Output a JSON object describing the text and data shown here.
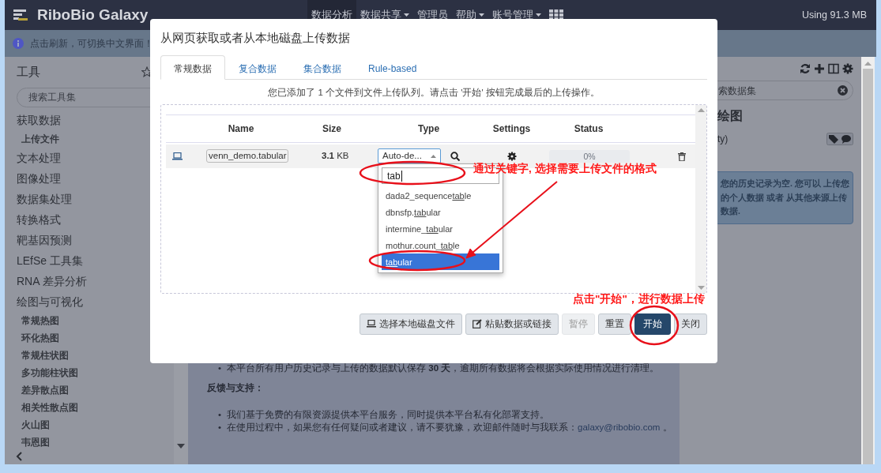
{
  "navbar": {
    "brand": "RiboBio Galaxy",
    "menu": [
      {
        "label": "数据分析",
        "dropdown": false,
        "selected": true
      },
      {
        "label": "数据共享",
        "dropdown": true,
        "selected": false
      },
      {
        "label": "管理员",
        "dropdown": false,
        "selected": false
      },
      {
        "label": "帮助",
        "dropdown": true,
        "selected": false
      },
      {
        "label": "账号管理",
        "dropdown": true,
        "selected": false
      }
    ],
    "usage": "Using 91.3 MB"
  },
  "notice": {
    "text": "点击刷新，可切换中文界面！"
  },
  "tool_panel": {
    "title": "工具",
    "search": {
      "placeholder": "搜索工具集"
    },
    "sections": [
      {
        "label": "获取数据",
        "children": [
          {
            "label": "上传文件"
          }
        ]
      },
      {
        "label": "文本处理"
      },
      {
        "label": "图像处理"
      },
      {
        "label": "数据集处理"
      },
      {
        "label": "转换格式"
      },
      {
        "label": "靶基因预测"
      },
      {
        "label": "LEfSe 工具集"
      },
      {
        "label": "RNA 差异分析"
      },
      {
        "label": "绘图与可视化",
        "children": [
          {
            "label": "常规热图"
          },
          {
            "label": "环化热图"
          },
          {
            "label": "常规柱状图"
          },
          {
            "label": "多功能柱状图"
          },
          {
            "label": "差异散点图"
          },
          {
            "label": "相关性散点图"
          },
          {
            "label": "火山图"
          },
          {
            "label": "韦恩图"
          }
        ]
      }
    ]
  },
  "center": {
    "top_bullets": [
      {
        "marker": "•",
        "text": "本平台所有用户历史记录与上传的数据默认保存 **30 天**，逾期所有数据将会根据实际使用情况进行清理。"
      }
    ],
    "heading": "反馈与支持：",
    "bullets": [
      {
        "marker": "•",
        "text": "我们基于免费的有限资源提供本平台服务，同时提供本平台私有化部署支持。"
      },
      {
        "marker": "•",
        "text": "在使用过程中，如果您有任何疑问或者建议，请不要犹豫，欢迎邮件随时与我联系：",
        "link": "galaxy@ribobio.com",
        "after": " 。"
      }
    ]
  },
  "history_panel": {
    "search": {
      "placeholder": "索数据集"
    },
    "title": "绘图",
    "subtitle": "ty)",
    "alert_lines": [
      "您的历史记录为空. 您可以 上传您",
      "的个人数据 或者 从其他来源上传",
      "数据."
    ]
  },
  "upload_dialog": {
    "title": "从网页获取或者从本地磁盘上传数据",
    "tabs": [
      {
        "label": "常规数据",
        "selected": true
      },
      {
        "label": "复合数据",
        "selected": false
      },
      {
        "label": "集合数据",
        "selected": false
      },
      {
        "label": "Rule-based",
        "selected": false
      }
    ],
    "message": "您已添加了 1 个文件到文件上传队列。请点击 '开始' 按钮完成最后的上传操作。",
    "columns": [
      "Name",
      "Size",
      "Type",
      "Settings",
      "Status"
    ],
    "files": [
      {
        "name": "venn_demo.tabular",
        "size": "**3.1** KB",
        "type": "Auto-de...",
        "progress": {
          "level": 0,
          "label": "0%"
        }
      }
    ],
    "type_dropdown": {
      "query": "tab",
      "options": [
        {
          "before": "dada2_sequence",
          "match": "tab",
          "after": "le",
          "selected": false
        },
        {
          "before": "dbnsfp.",
          "match": "tab",
          "after": "ular",
          "selected": false
        },
        {
          "before": "intermine_",
          "match": "tab",
          "after": "ular",
          "selected": false
        },
        {
          "before": "mothur.count_",
          "match": "tab",
          "after": "le",
          "selected": false
        },
        {
          "match": "tab",
          "after": "ular",
          "selected": true
        }
      ]
    },
    "buttons": [
      {
        "label": "选择本地磁盘文件",
        "kind": "file",
        "disabled": false
      },
      {
        "label": "粘贴数据或链接",
        "kind": "paste",
        "disabled": false
      },
      {
        "label": "暂停",
        "kind": "plain",
        "disabled": true
      },
      {
        "label": "重置",
        "kind": "plain",
        "disabled": false
      },
      {
        "label": "开始",
        "kind": "primary",
        "disabled": false
      },
      {
        "label": "关闭",
        "kind": "plain",
        "disabled": false
      }
    ],
    "annotations": [
      {
        "text": "通过关键字, 选择需要上传文件的格式"
      },
      {
        "text": "点击\"开始\"，进行数据上传"
      }
    ]
  }
}
